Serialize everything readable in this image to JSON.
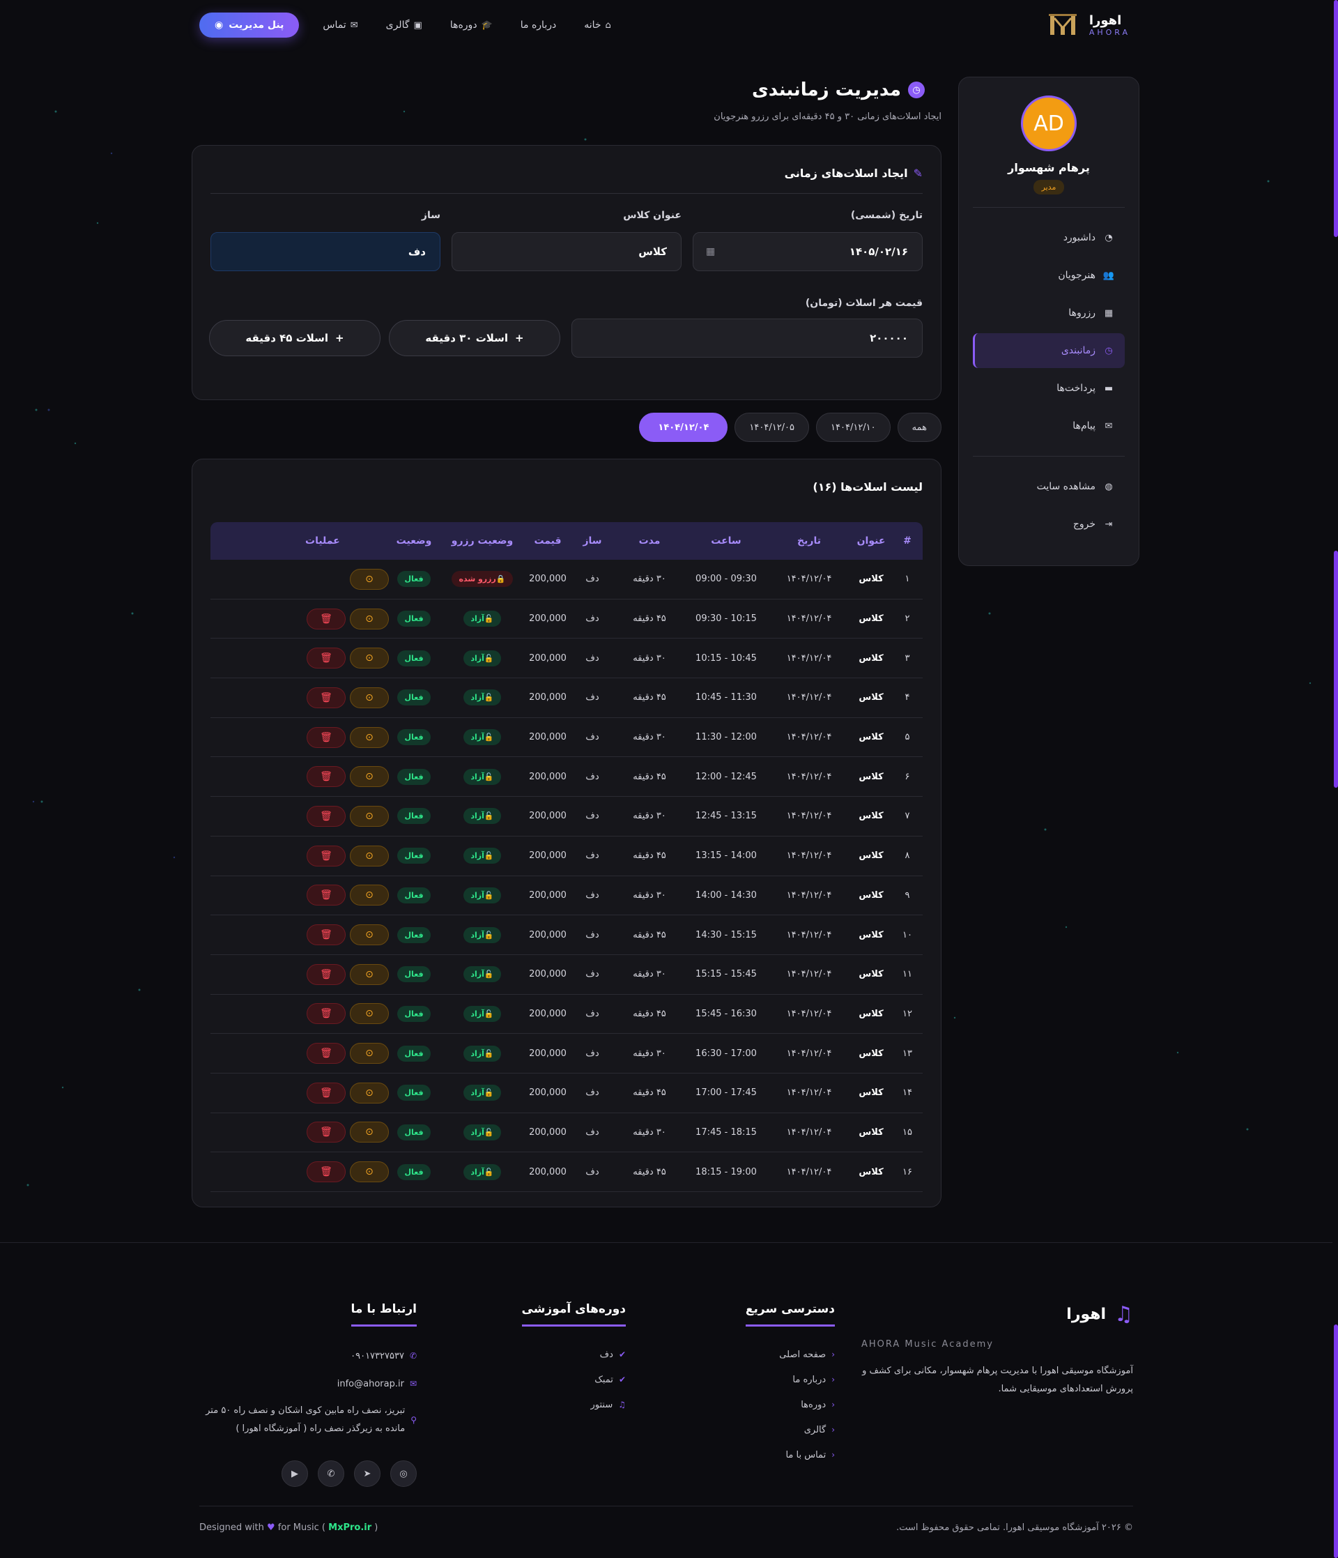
{
  "header": {
    "brand_name": "اهورا",
    "brand_sub": "AHORA",
    "nav": [
      {
        "label": "خانه",
        "icon": "home-icon"
      },
      {
        "label": "درباره ما",
        "icon": ""
      },
      {
        "label": "دوره‌ها",
        "icon": "graduation-cap-icon"
      },
      {
        "label": "گالری",
        "icon": "images-icon"
      },
      {
        "label": "تماس",
        "icon": "envelope-icon"
      }
    ],
    "admin_button": "پنل مدیریت"
  },
  "sidebar": {
    "avatar_initials": "AD",
    "user_name": "پرهام شهسوار",
    "user_role": "مدیر",
    "items": [
      {
        "label": "داشبورد",
        "icon": "dashboard-icon"
      },
      {
        "label": "هنرجویان",
        "icon": "users-icon"
      },
      {
        "label": "رزروها",
        "icon": "calendar-check-icon"
      },
      {
        "label": "زمانبندی",
        "icon": "clock-icon",
        "active": true
      },
      {
        "label": "پرداخت‌ها",
        "icon": "wallet-icon"
      },
      {
        "label": "پیام‌ها",
        "icon": "envelope-icon"
      }
    ],
    "bottom_items": [
      {
        "label": "مشاهده سایت",
        "icon": "globe-icon"
      },
      {
        "label": "خروج",
        "icon": "sign-out-icon"
      }
    ]
  },
  "page": {
    "title": "مدیریت زمانبندی",
    "subtitle": "ایجاد اسلات‌های زمانی ۳۰ و ۴۵ دقیقه‌ای برای رزرو هنرجویان"
  },
  "form": {
    "title": "ایجاد اسلات‌های زمانی",
    "date_label": "تاریخ (شمسی)",
    "date_value": "۱۴۰۵/۰۲/۱۶",
    "class_label": "عنوان کلاس",
    "class_value": "کلاس",
    "instrument_label": "ساز",
    "instrument_value": "دف",
    "price_label": "قیمت هر اسلات (تومان)",
    "price_value": "۲۰۰۰۰۰",
    "btn_30": "اسلات ۳۰ دقیقه",
    "btn_45": "اسلات ۴۵ دقیقه"
  },
  "filters": [
    "همه",
    "۱۴۰۴/۱۲/۱۰",
    "۱۴۰۴/۱۲/۰۵",
    "۱۴۰۴/۱۲/۰۴"
  ],
  "active_filter": "۱۴۰۴/۱۲/۰۴",
  "table": {
    "title": "لیست اسلات‌ها (۱۶)",
    "headers": [
      "#",
      "عنوان",
      "تاریخ",
      "ساعت",
      "مدت",
      "ساز",
      "قیمت",
      "وضعیت رزرو",
      "وضعیت",
      "عملیات"
    ],
    "reserved_label": "رزرو شده",
    "free_label": "آزاد",
    "active_label": "فعال",
    "rows": [
      {
        "n": "۱",
        "title": "کلاس",
        "date": "۱۴۰۴/۱۲/۰۴",
        "time": "09:00 - 09:30",
        "dur": "۳۰ دقیقه",
        "inst": "دف",
        "price": "200,000",
        "reserved": true
      },
      {
        "n": "۲",
        "title": "کلاس",
        "date": "۱۴۰۴/۱۲/۰۴",
        "time": "09:30 - 10:15",
        "dur": "۴۵ دقیقه",
        "inst": "دف",
        "price": "200,000",
        "reserved": false
      },
      {
        "n": "۳",
        "title": "کلاس",
        "date": "۱۴۰۴/۱۲/۰۴",
        "time": "10:15 - 10:45",
        "dur": "۳۰ دقیقه",
        "inst": "دف",
        "price": "200,000",
        "reserved": false
      },
      {
        "n": "۴",
        "title": "کلاس",
        "date": "۱۴۰۴/۱۲/۰۴",
        "time": "10:45 - 11:30",
        "dur": "۴۵ دقیقه",
        "inst": "دف",
        "price": "200,000",
        "reserved": false
      },
      {
        "n": "۵",
        "title": "کلاس",
        "date": "۱۴۰۴/۱۲/۰۴",
        "time": "11:30 - 12:00",
        "dur": "۳۰ دقیقه",
        "inst": "دف",
        "price": "200,000",
        "reserved": false
      },
      {
        "n": "۶",
        "title": "کلاس",
        "date": "۱۴۰۴/۱۲/۰۴",
        "time": "12:00 - 12:45",
        "dur": "۴۵ دقیقه",
        "inst": "دف",
        "price": "200,000",
        "reserved": false
      },
      {
        "n": "۷",
        "title": "کلاس",
        "date": "۱۴۰۴/۱۲/۰۴",
        "time": "12:45 - 13:15",
        "dur": "۳۰ دقیقه",
        "inst": "دف",
        "price": "200,000",
        "reserved": false
      },
      {
        "n": "۸",
        "title": "کلاس",
        "date": "۱۴۰۴/۱۲/۰۴",
        "time": "13:15 - 14:00",
        "dur": "۴۵ دقیقه",
        "inst": "دف",
        "price": "200,000",
        "reserved": false
      },
      {
        "n": "۹",
        "title": "کلاس",
        "date": "۱۴۰۴/۱۲/۰۴",
        "time": "14:00 - 14:30",
        "dur": "۳۰ دقیقه",
        "inst": "دف",
        "price": "200,000",
        "reserved": false
      },
      {
        "n": "۱۰",
        "title": "کلاس",
        "date": "۱۴۰۴/۱۲/۰۴",
        "time": "14:30 - 15:15",
        "dur": "۴۵ دقیقه",
        "inst": "دف",
        "price": "200,000",
        "reserved": false
      },
      {
        "n": "۱۱",
        "title": "کلاس",
        "date": "۱۴۰۴/۱۲/۰۴",
        "time": "15:15 - 15:45",
        "dur": "۳۰ دقیقه",
        "inst": "دف",
        "price": "200,000",
        "reserved": false
      },
      {
        "n": "۱۲",
        "title": "کلاس",
        "date": "۱۴۰۴/۱۲/۰۴",
        "time": "15:45 - 16:30",
        "dur": "۴۵ دقیقه",
        "inst": "دف",
        "price": "200,000",
        "reserved": false
      },
      {
        "n": "۱۳",
        "title": "کلاس",
        "date": "۱۴۰۴/۱۲/۰۴",
        "time": "16:30 - 17:00",
        "dur": "۳۰ دقیقه",
        "inst": "دف",
        "price": "200,000",
        "reserved": false
      },
      {
        "n": "۱۴",
        "title": "کلاس",
        "date": "۱۴۰۴/۱۲/۰۴",
        "time": "17:00 - 17:45",
        "dur": "۴۵ دقیقه",
        "inst": "دف",
        "price": "200,000",
        "reserved": false
      },
      {
        "n": "۱۵",
        "title": "کلاس",
        "date": "۱۴۰۴/۱۲/۰۴",
        "time": "17:45 - 18:15",
        "dur": "۳۰ دقیقه",
        "inst": "دف",
        "price": "200,000",
        "reserved": false
      },
      {
        "n": "۱۶",
        "title": "کلاس",
        "date": "۱۴۰۴/۱۲/۰۴",
        "time": "18:15 - 19:00",
        "dur": "۴۵ دقیقه",
        "inst": "دف",
        "price": "200,000",
        "reserved": false
      }
    ]
  },
  "footer": {
    "brand_name": "اهورا",
    "brand_sub": "AHORA Music Academy",
    "description": "آموزشگاه موسیقی اهورا با مدیریت پرهام شهسوار، مکانی برای کشف و پرورش استعدادهای موسیقایی شما.",
    "quick_title": "دسترسی سریع",
    "quick_links": [
      "صفحه اصلی",
      "درباره ما",
      "دوره‌ها",
      "گالری",
      "تماس با ما"
    ],
    "courses_title": "دوره‌های آموزشی",
    "courses": [
      "دف",
      "تمبک",
      "سنتور"
    ],
    "contact_title": "ارتباط با ما",
    "phone": "۰۹۰۱۷۳۲۷۵۳۷",
    "email": "info@ahorap.ir",
    "address": "تبریز، نصف راه مابین کوی اشکان و نصف راه ۵۰ متر مانده به زیرگذر نصف راه ( آموزشگاه اهورا )",
    "copyright": "© ۲۰۲۶ آموزشگاه موسیقی اهورا. تمامی حقوق محفوظ است.",
    "credit_prefix": "Designed with",
    "credit_mid": "for Music (",
    "credit_site": "MxPro.ir",
    "credit_suffix": ")"
  },
  "colors": {
    "accent": "#8b5cf6",
    "background": "#0c0c10",
    "success": "#2ee58a",
    "danger": "#ff5a6a",
    "warning": "#f5a623"
  }
}
